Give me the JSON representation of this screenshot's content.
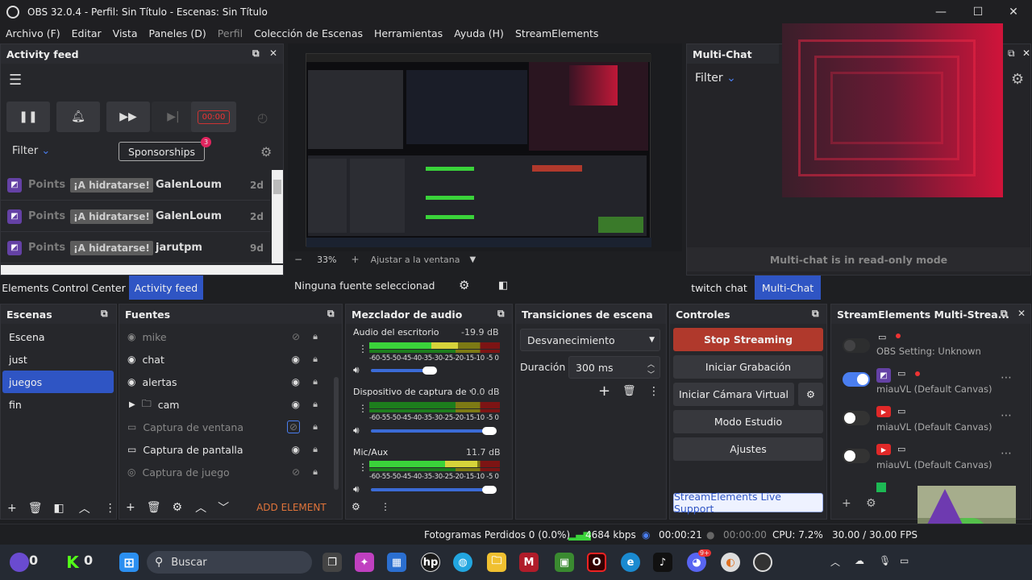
{
  "titlebar": {
    "title": "OBS 32.0.4 - Perfil: Sin Título - Escenas: Sin Título",
    "minimize": "—",
    "maximize": "☐",
    "close": "✕"
  },
  "menu": {
    "items": [
      "Archivo (F)",
      "Editar",
      "Vista",
      "Paneles (D)",
      "Perfil",
      "Colección de Escenas",
      "Herramientas",
      "Ayuda (H)",
      "StreamElements"
    ]
  },
  "activity_feed": {
    "title": "Activity feed",
    "timer": "00:00",
    "filter": "Filter",
    "sponsorships": "Sponsorships",
    "sponsor_badge": "3",
    "rows": [
      {
        "platform": "Points",
        "reward": "¡A hidratarse!",
        "user": "GalenLoum",
        "age": "2d"
      },
      {
        "platform": "Points",
        "reward": "¡A hidratarse!",
        "user": "GalenLoum",
        "age": "2d"
      },
      {
        "platform": "Points",
        "reward": "¡A hidratarse!",
        "user": "jarutpm",
        "age": "9d"
      }
    ]
  },
  "left_tabs": {
    "elements_control_center": "Elements Control Center",
    "activity_feed": "Activity feed"
  },
  "preview": {
    "zoom": "33%",
    "fit_label": "Ajustar a la ventana",
    "minus": "−",
    "plus": "+",
    "no_source": "Ninguna fuente seleccionad"
  },
  "multichat": {
    "title": "Multi-Chat",
    "filter": "Filter",
    "readonly": "Multi-chat is in read-only mode",
    "tab_twitch": "twitch chat",
    "tab_multi": "Multi-Chat"
  },
  "scenes": {
    "title": "Escenas",
    "items": [
      "Escena",
      "just",
      "juegos",
      "fin"
    ],
    "selected": "juegos"
  },
  "sources": {
    "title": "Fuentes",
    "add_element": "ADD ELEMENT",
    "items": [
      {
        "name": "mike",
        "icon": "audio-icon",
        "dim": true
      },
      {
        "name": "chat",
        "icon": "browser-icon",
        "dim": false
      },
      {
        "name": "alertas",
        "icon": "browser-icon",
        "dim": false
      },
      {
        "name": "cam",
        "icon": "folder-icon",
        "dim": false
      },
      {
        "name": "Captura de ventana",
        "icon": "window-icon",
        "dim": true
      },
      {
        "name": "Captura de pantalla",
        "icon": "monitor-icon",
        "dim": false
      },
      {
        "name": "Captura de juego",
        "icon": "gamepad-icon",
        "dim": true
      }
    ]
  },
  "mixer": {
    "title": "Mezclador de audio",
    "scale": "-60-55-50-45-40-35-30-25-20-15-10 -5  0",
    "channels": [
      {
        "name": "Audio del escritorio",
        "db": "-19.9 dB",
        "level": 0.68,
        "volume": 0.5
      },
      {
        "name": "Dispositivo de captura de vide",
        "db": "0.0 dB",
        "level": 0.0,
        "volume": 1.0
      },
      {
        "name": "Mic/Aux",
        "db": "11.7 dB",
        "level": 0.83,
        "volume": 1.0
      }
    ]
  },
  "transitions": {
    "title": "Transiciones de escena",
    "selected": "Desvanecimiento",
    "duration_label": "Duración",
    "duration": "300 ms"
  },
  "controls": {
    "title": "Controles",
    "stop_streaming": "Stop Streaming",
    "record": "Iniciar Grabación",
    "virtual_cam": "Iniciar Cámara Virtual",
    "studio": "Modo Estudio",
    "settings": "Ajustes",
    "live_support": "StreamElements Live Support"
  },
  "multistream": {
    "title": "StreamElements Multi-Strea...",
    "rows": [
      {
        "label": "OBS Setting: Unknown",
        "enabled": false,
        "platform": "none"
      },
      {
        "label": "miauVL (Default Canvas)",
        "enabled": true,
        "platform": "twitch"
      },
      {
        "label": "miauVL (Default Canvas)",
        "enabled": false,
        "platform": "youtube"
      },
      {
        "label": "miauVL (Default Canvas)",
        "enabled": false,
        "platform": "youtube"
      }
    ]
  },
  "statusbar": {
    "dropped": "Fotogramas Perdidos 0 (0.0%)",
    "bitrate": "4684 kbps",
    "stream_time": "00:00:21",
    "rec_time": "00:00:00",
    "cpu": "CPU: 7.2%",
    "fps": "30.00 / 30.00 FPS"
  },
  "taskbar": {
    "search": "Buscar",
    "counter1": "0",
    "counter2": "0",
    "discord_badge": "9+"
  }
}
